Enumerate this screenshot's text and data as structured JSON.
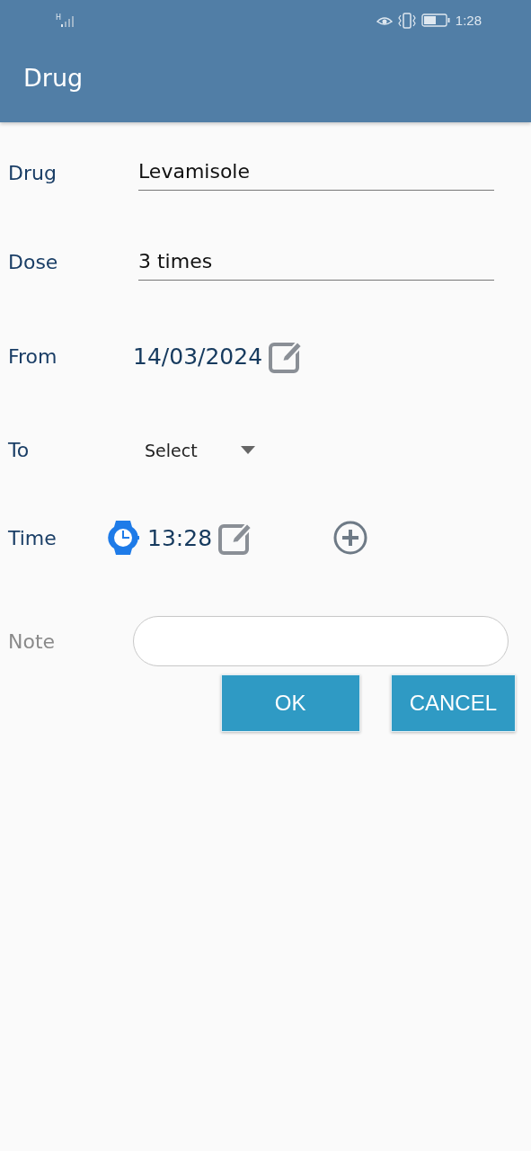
{
  "status_bar": {
    "network": "H",
    "time": "1:28"
  },
  "app_bar": {
    "title": "Drug"
  },
  "form": {
    "drug": {
      "label": "Drug",
      "value": "Levamisole"
    },
    "dose": {
      "label": "Dose",
      "value": "3 times"
    },
    "from": {
      "label": "From",
      "value": "14/03/2024"
    },
    "to": {
      "label": "To",
      "value": "Select"
    },
    "time": {
      "label": "Time",
      "value": "13:28"
    },
    "note": {
      "label": "Note"
    }
  },
  "buttons": [
    {
      "label": "OK"
    },
    {
      "label": "CANCEL"
    }
  ]
}
